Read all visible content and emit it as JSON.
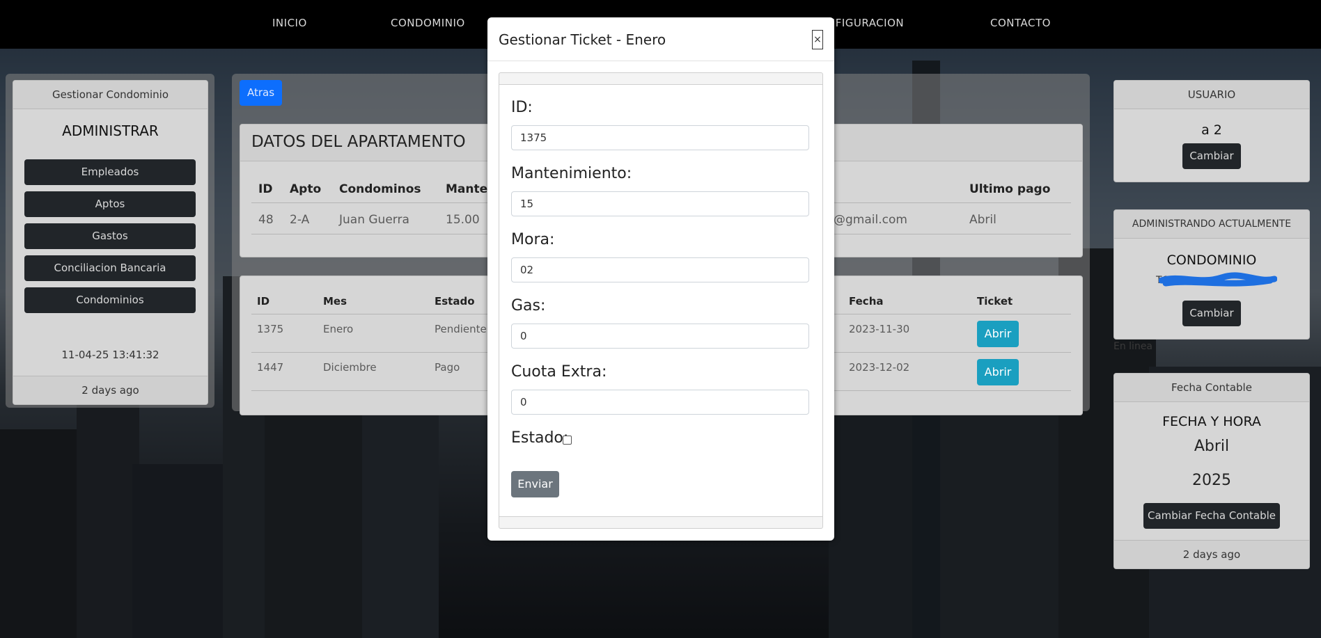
{
  "nav": {
    "items": [
      "INICIO",
      "CONDOMINIO",
      "NFIGURACION",
      "CONTACTO"
    ]
  },
  "left": {
    "header": "Gestionar Condominio",
    "title": "ADMINISTRAR",
    "buttons": [
      "Empleados",
      "Aptos",
      "Gastos",
      "Conciliacion Bancaria",
      "Condominios"
    ],
    "datetime": "11-04-25 13:41:32",
    "footer": "2 days ago"
  },
  "center": {
    "back_label": "Atras",
    "apt_title": "DATOS DEL APARTAMENTO",
    "apt_headers": [
      "ID",
      "Apto",
      "Condominos",
      "Manten",
      "Ultimo pago"
    ],
    "apt_row": [
      "48",
      "2-A",
      "Juan Guerra",
      "15.00",
      "@gmail.com",
      "Abril"
    ],
    "tickets_headers": [
      "ID",
      "Mes",
      "Estado",
      "Fecha",
      "Ticket"
    ],
    "tickets": [
      {
        "id": "1375",
        "mes": "Enero",
        "estado": "Pendiente",
        "fecha": "2023-11-30",
        "action": "Abrir"
      },
      {
        "id": "1447",
        "mes": "Diciembre",
        "estado": "Pago",
        "fecha": "2023-12-02",
        "action": "Abrir"
      }
    ]
  },
  "right": {
    "user_header": "USUARIO",
    "user_name": "a 2",
    "user_change": "Cambiar",
    "admin_header": "ADMINISTRANDO ACTUALMENTE",
    "admin_title": "CONDOMINIO",
    "admin_sub": "TOR",
    "admin_change": "Cambiar",
    "side_text": "En linea",
    "fecha_header": "Fecha Contable",
    "fecha_title": "FECHA Y HORA",
    "fecha_month": "Abril",
    "fecha_year": "2025",
    "fecha_change": "Cambiar Fecha Contable",
    "fecha_footer": "2 days ago"
  },
  "modal": {
    "title": "Gestionar Ticket - Enero",
    "close": "×",
    "fields": {
      "id_label": "ID:",
      "id_value": "1375",
      "mant_label": "Mantenimiento:",
      "mant_value": "15",
      "mora_label": "Mora:",
      "mora_value": "02",
      "gas_label": "Gas:",
      "gas_value": "0",
      "cuota_label": "Cuota Extra:",
      "cuota_value": "0",
      "estado_label": "Estado:"
    },
    "submit": "Enviar"
  },
  "colors": {
    "accent_blue": "#0d6efd",
    "abrir_cyan": "#1a9fc0",
    "dark_button": "#212529",
    "scribble": "#1e6fe0"
  }
}
